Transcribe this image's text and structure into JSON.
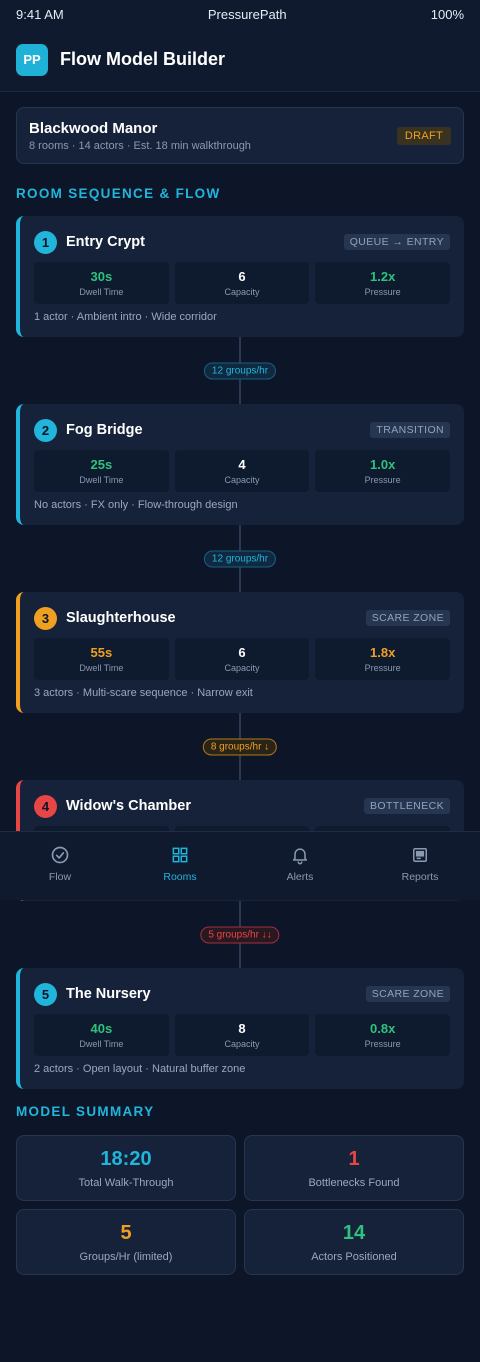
{
  "status_bar": {
    "time": "9:41 AM",
    "app": "PressurePath",
    "battery": "100%"
  },
  "header": {
    "logo": "PP",
    "title": "Flow Model Builder"
  },
  "venue": {
    "name": "Blackwood Manor",
    "meta": "8 rooms · 14 actors · Est. 18 min walkthrough",
    "badge": "DRAFT"
  },
  "sequence_title": "ROOM SEQUENCE & FLOW",
  "rooms": [
    {
      "num": "1",
      "name": "Entry Crypt",
      "tag": "QUEUE → ENTRY",
      "accent": "#22b5dc",
      "stats": [
        {
          "value": "30s",
          "label": "Dwell Time",
          "color": "#2ec27e"
        },
        {
          "value": "6",
          "label": "Capacity",
          "color": "#ffffff"
        },
        {
          "value": "1.2x",
          "label": "Pressure",
          "color": "#2ec27e"
        }
      ],
      "desc": "1 actor · Ambient intro · Wide corridor"
    },
    {
      "num": "2",
      "name": "Fog Bridge",
      "tag": "TRANSITION",
      "accent": "#22b5dc",
      "stats": [
        {
          "value": "25s",
          "label": "Dwell Time",
          "color": "#2ec27e"
        },
        {
          "value": "4",
          "label": "Capacity",
          "color": "#ffffff"
        },
        {
          "value": "1.0x",
          "label": "Pressure",
          "color": "#2ec27e"
        }
      ],
      "desc": "No actors · FX only · Flow-through design"
    },
    {
      "num": "3",
      "name": "Slaughterhouse",
      "tag": "SCARE ZONE",
      "accent": "#f0a020",
      "stats": [
        {
          "value": "55s",
          "label": "Dwell Time",
          "color": "#f0a020"
        },
        {
          "value": "6",
          "label": "Capacity",
          "color": "#ffffff"
        },
        {
          "value": "1.8x",
          "label": "Pressure",
          "color": "#f0a020"
        }
      ],
      "desc": "3 actors · Multi-scare sequence · Narrow exit"
    },
    {
      "num": "4",
      "name": "Widow's Chamber",
      "tag": "BOTTLENECK",
      "accent": "#e84545",
      "stats": [
        {
          "value": "",
          "label": "",
          "color": "#e84545"
        },
        {
          "value": "",
          "label": "",
          "color": "#ffffff"
        },
        {
          "value": "",
          "label": "",
          "color": "#e84545"
        }
      ],
      "desc": ""
    },
    {
      "num": "5",
      "name": "The Nursery",
      "tag": "SCARE ZONE",
      "accent": "#22b5dc",
      "stats": [
        {
          "value": "40s",
          "label": "Dwell Time",
          "color": "#2ec27e"
        },
        {
          "value": "8",
          "label": "Capacity",
          "color": "#ffffff"
        },
        {
          "value": "0.8x",
          "label": "Pressure",
          "color": "#2ec27e"
        }
      ],
      "desc": "2 actors · Open layout · Natural buffer zone"
    }
  ],
  "flows": [
    {
      "label": "12 groups/hr",
      "status": "normal"
    },
    {
      "label": "12 groups/hr",
      "status": "normal"
    },
    {
      "label": "8 groups/hr ↓",
      "status": "warning"
    },
    {
      "label": "5 groups/hr ↓↓",
      "status": "critical"
    }
  ],
  "summary_title": "MODEL SUMMARY",
  "summary": [
    {
      "value": "18:20",
      "label": "Total Walk-Through",
      "color": "#22b5dc"
    },
    {
      "value": "1",
      "label": "Bottlenecks Found",
      "color": "#e84545"
    },
    {
      "value": "5",
      "label": "Groups/Hr (limited)",
      "color": "#f0a020"
    },
    {
      "value": "14",
      "label": "Actors Positioned",
      "color": "#2ec27e"
    }
  ],
  "tabs": [
    {
      "label": "Flow",
      "icon": "check-circle-icon",
      "active": false
    },
    {
      "label": "Rooms",
      "icon": "grid-icon",
      "active": true
    },
    {
      "label": "Alerts",
      "icon": "bell-icon",
      "active": false
    },
    {
      "label": "Reports",
      "icon": "report-icon",
      "active": false
    }
  ],
  "colors": {
    "accent": "#22b5dc",
    "warning": "#f0a020",
    "danger": "#e84545",
    "success": "#2ec27e",
    "background": "#0c1628"
  }
}
